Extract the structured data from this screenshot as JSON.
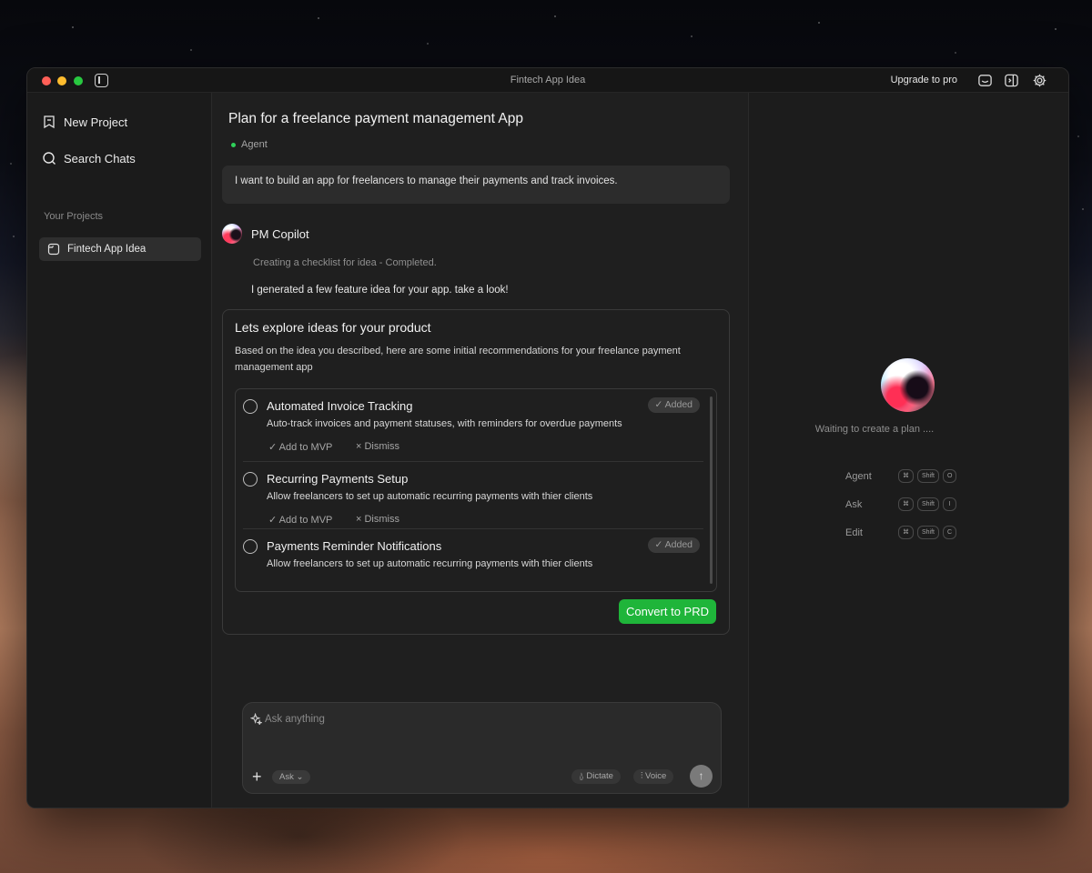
{
  "window": {
    "title": "Fintech App Idea",
    "upgrade_label": "Upgrade to pro"
  },
  "sidebar": {
    "new_project": "New Project",
    "search_chats": "Search Chats",
    "section_label": "Your Projects",
    "projects": [
      {
        "label": "Fintech App Idea"
      }
    ]
  },
  "chat": {
    "title": "Plan for a freelance payment management App",
    "mode": "Agent",
    "user_message": "I want to build an app for freelancers to manage their payments and track invoices.",
    "assistant_name": "PM Copilot",
    "status": "Creating a checklist for idea - Completed.",
    "intro": "I generated a few feature idea for your app. take a look!",
    "card": {
      "title": "Lets explore ideas for your product",
      "description": "Based on the idea you described, here are some initial recommendations for your freelance payment management app",
      "features": [
        {
          "title": "Automated Invoice Tracking",
          "description": "Auto-track invoices and payment statuses, with reminders for overdue payments",
          "badge": "✓ Added",
          "add": "✓ Add to MVP",
          "dismiss": "× Dismiss"
        },
        {
          "title": "Recurring Payments Setup",
          "description": "Allow freelancers to set up automatic recurring payments with thier clients",
          "add": "✓ Add to MVP",
          "dismiss": "× Dismiss"
        },
        {
          "title": "Payments Reminder Notifications",
          "description": "Allow freelancers to set up automatic recurring payments with thier clients",
          "badge": "✓ Added"
        }
      ],
      "convert_label": "Convert to PRD"
    }
  },
  "composer": {
    "placeholder": "Ask anything",
    "mode_label": "Ask ⌄",
    "dictate_label": "Dictate",
    "voice_label": "Voice",
    "send_icon": "↑"
  },
  "plan_panel": {
    "waiting": "Waiting to create a plan ....",
    "shortcuts": [
      {
        "label": "Agent",
        "keys": [
          "⌘",
          "Shift",
          "O"
        ]
      },
      {
        "label": "Ask",
        "keys": [
          "⌘",
          "Shift",
          "I"
        ]
      },
      {
        "label": "Edit",
        "keys": [
          "⌘",
          "Shift",
          "C"
        ]
      }
    ]
  }
}
